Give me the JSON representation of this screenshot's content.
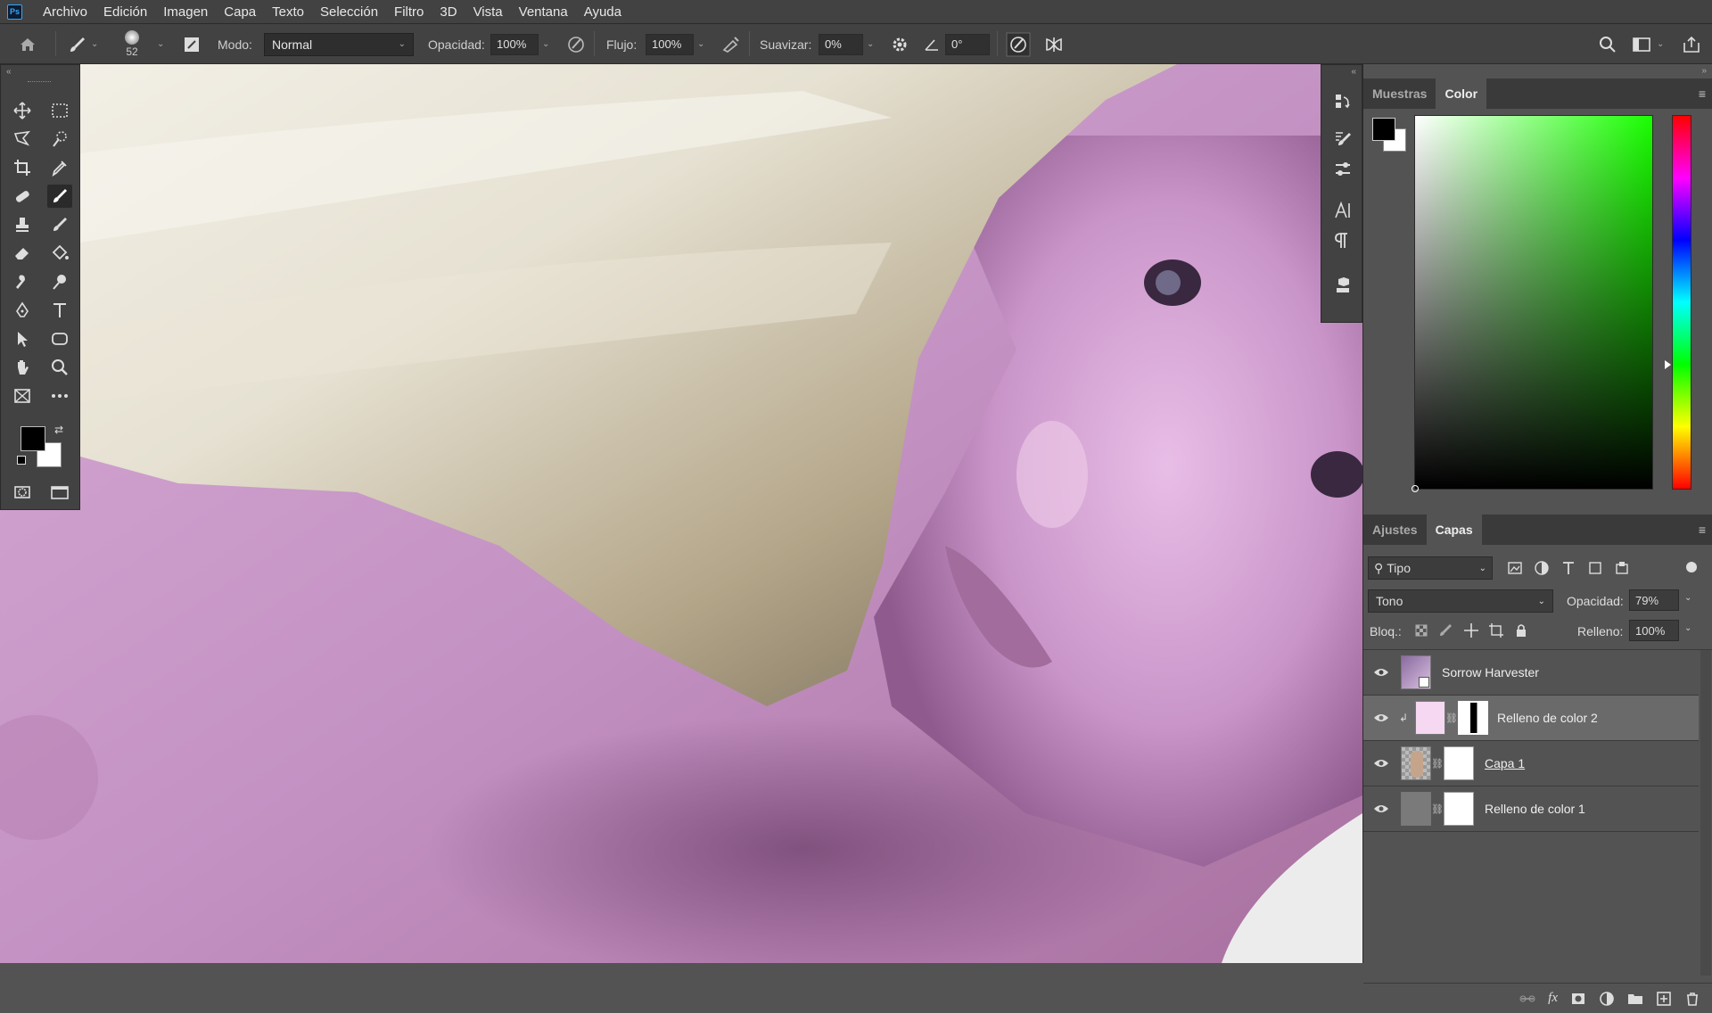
{
  "app": {
    "logo": "Ps"
  },
  "menu": [
    "Archivo",
    "Edición",
    "Imagen",
    "Capa",
    "Texto",
    "Selección",
    "Filtro",
    "3D",
    "Vista",
    "Ventana",
    "Ayuda"
  ],
  "options": {
    "brush_size": "52",
    "mode_label": "Modo:",
    "mode_value": "Normal",
    "opacity_label": "Opacidad:",
    "opacity_value": "100%",
    "flow_label": "Flujo:",
    "flow_value": "100%",
    "smooth_label": "Suavizar:",
    "smooth_value": "0%",
    "angle_value": "0°"
  },
  "color_panel": {
    "tabs": [
      "Muestras",
      "Color"
    ],
    "active_tab": "Color",
    "foreground": "#000000",
    "background": "#ffffff",
    "hue_color": "#19ff00"
  },
  "layers_panel": {
    "tabs": [
      "Ajustes",
      "Capas"
    ],
    "active_tab": "Capas",
    "filter_value": "Tipo",
    "blend_mode": "Tono",
    "opacity_label": "Opacidad:",
    "opacity_value": "79%",
    "lock_label": "Bloq.:",
    "fill_label": "Relleno:",
    "fill_value": "100%",
    "layers": [
      {
        "name": "Sorrow Harvester",
        "selected": false
      },
      {
        "name": "Relleno de color 2",
        "selected": true
      },
      {
        "name": "Capa 1",
        "selected": false
      },
      {
        "name": "Relleno de color 1",
        "selected": false
      }
    ]
  },
  "footer_fx": "fx"
}
